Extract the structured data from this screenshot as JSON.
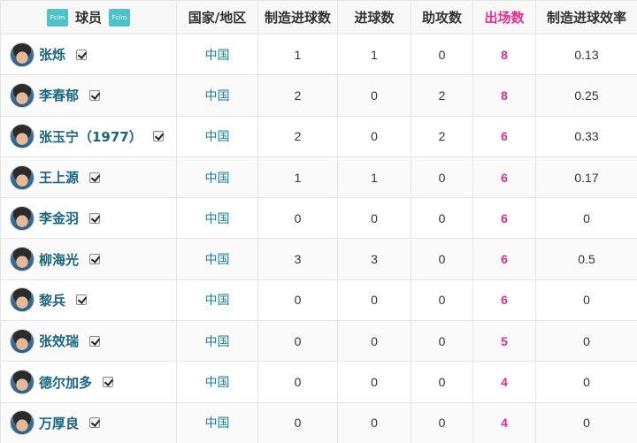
{
  "header": {
    "logo_text": "Fcim",
    "player": "球员",
    "country": "国家/地区",
    "chances_created": "制造进球数",
    "goals": "进球数",
    "assists": "助攻数",
    "appearances": "出场数",
    "efficiency": "制造进球效率"
  },
  "colors": {
    "accent_pink": "#e62e8b",
    "link_teal": "#1a6680",
    "logo_teal": "#4fc3c7"
  },
  "rows": [
    {
      "name": "张烁",
      "country": "中国",
      "created": "1",
      "goals": "1",
      "assists": "0",
      "apps": "8",
      "eff": "0.13",
      "checked": true
    },
    {
      "name": "李春郁",
      "country": "中国",
      "created": "2",
      "goals": "0",
      "assists": "2",
      "apps": "8",
      "eff": "0.25",
      "checked": true
    },
    {
      "name": "张玉宁（1977）",
      "country": "中国",
      "created": "2",
      "goals": "0",
      "assists": "2",
      "apps": "6",
      "eff": "0.33",
      "checked": true
    },
    {
      "name": "王上源",
      "country": "中国",
      "created": "1",
      "goals": "1",
      "assists": "0",
      "apps": "6",
      "eff": "0.17",
      "checked": true
    },
    {
      "name": "李金羽",
      "country": "中国",
      "created": "0",
      "goals": "0",
      "assists": "0",
      "apps": "6",
      "eff": "0",
      "checked": true
    },
    {
      "name": "柳海光",
      "country": "中国",
      "created": "3",
      "goals": "3",
      "assists": "0",
      "apps": "6",
      "eff": "0.5",
      "checked": true
    },
    {
      "name": "黎兵",
      "country": "中国",
      "created": "0",
      "goals": "0",
      "assists": "0",
      "apps": "6",
      "eff": "0",
      "checked": true
    },
    {
      "name": "张效瑞",
      "country": "中国",
      "created": "0",
      "goals": "0",
      "assists": "0",
      "apps": "5",
      "eff": "0",
      "checked": true
    },
    {
      "name": "德尔加多",
      "country": "中国",
      "created": "0",
      "goals": "0",
      "assists": "0",
      "apps": "4",
      "eff": "0",
      "checked": true
    },
    {
      "name": "万厚良",
      "country": "中国",
      "created": "0",
      "goals": "0",
      "assists": "0",
      "apps": "4",
      "eff": "0",
      "checked": true
    }
  ]
}
